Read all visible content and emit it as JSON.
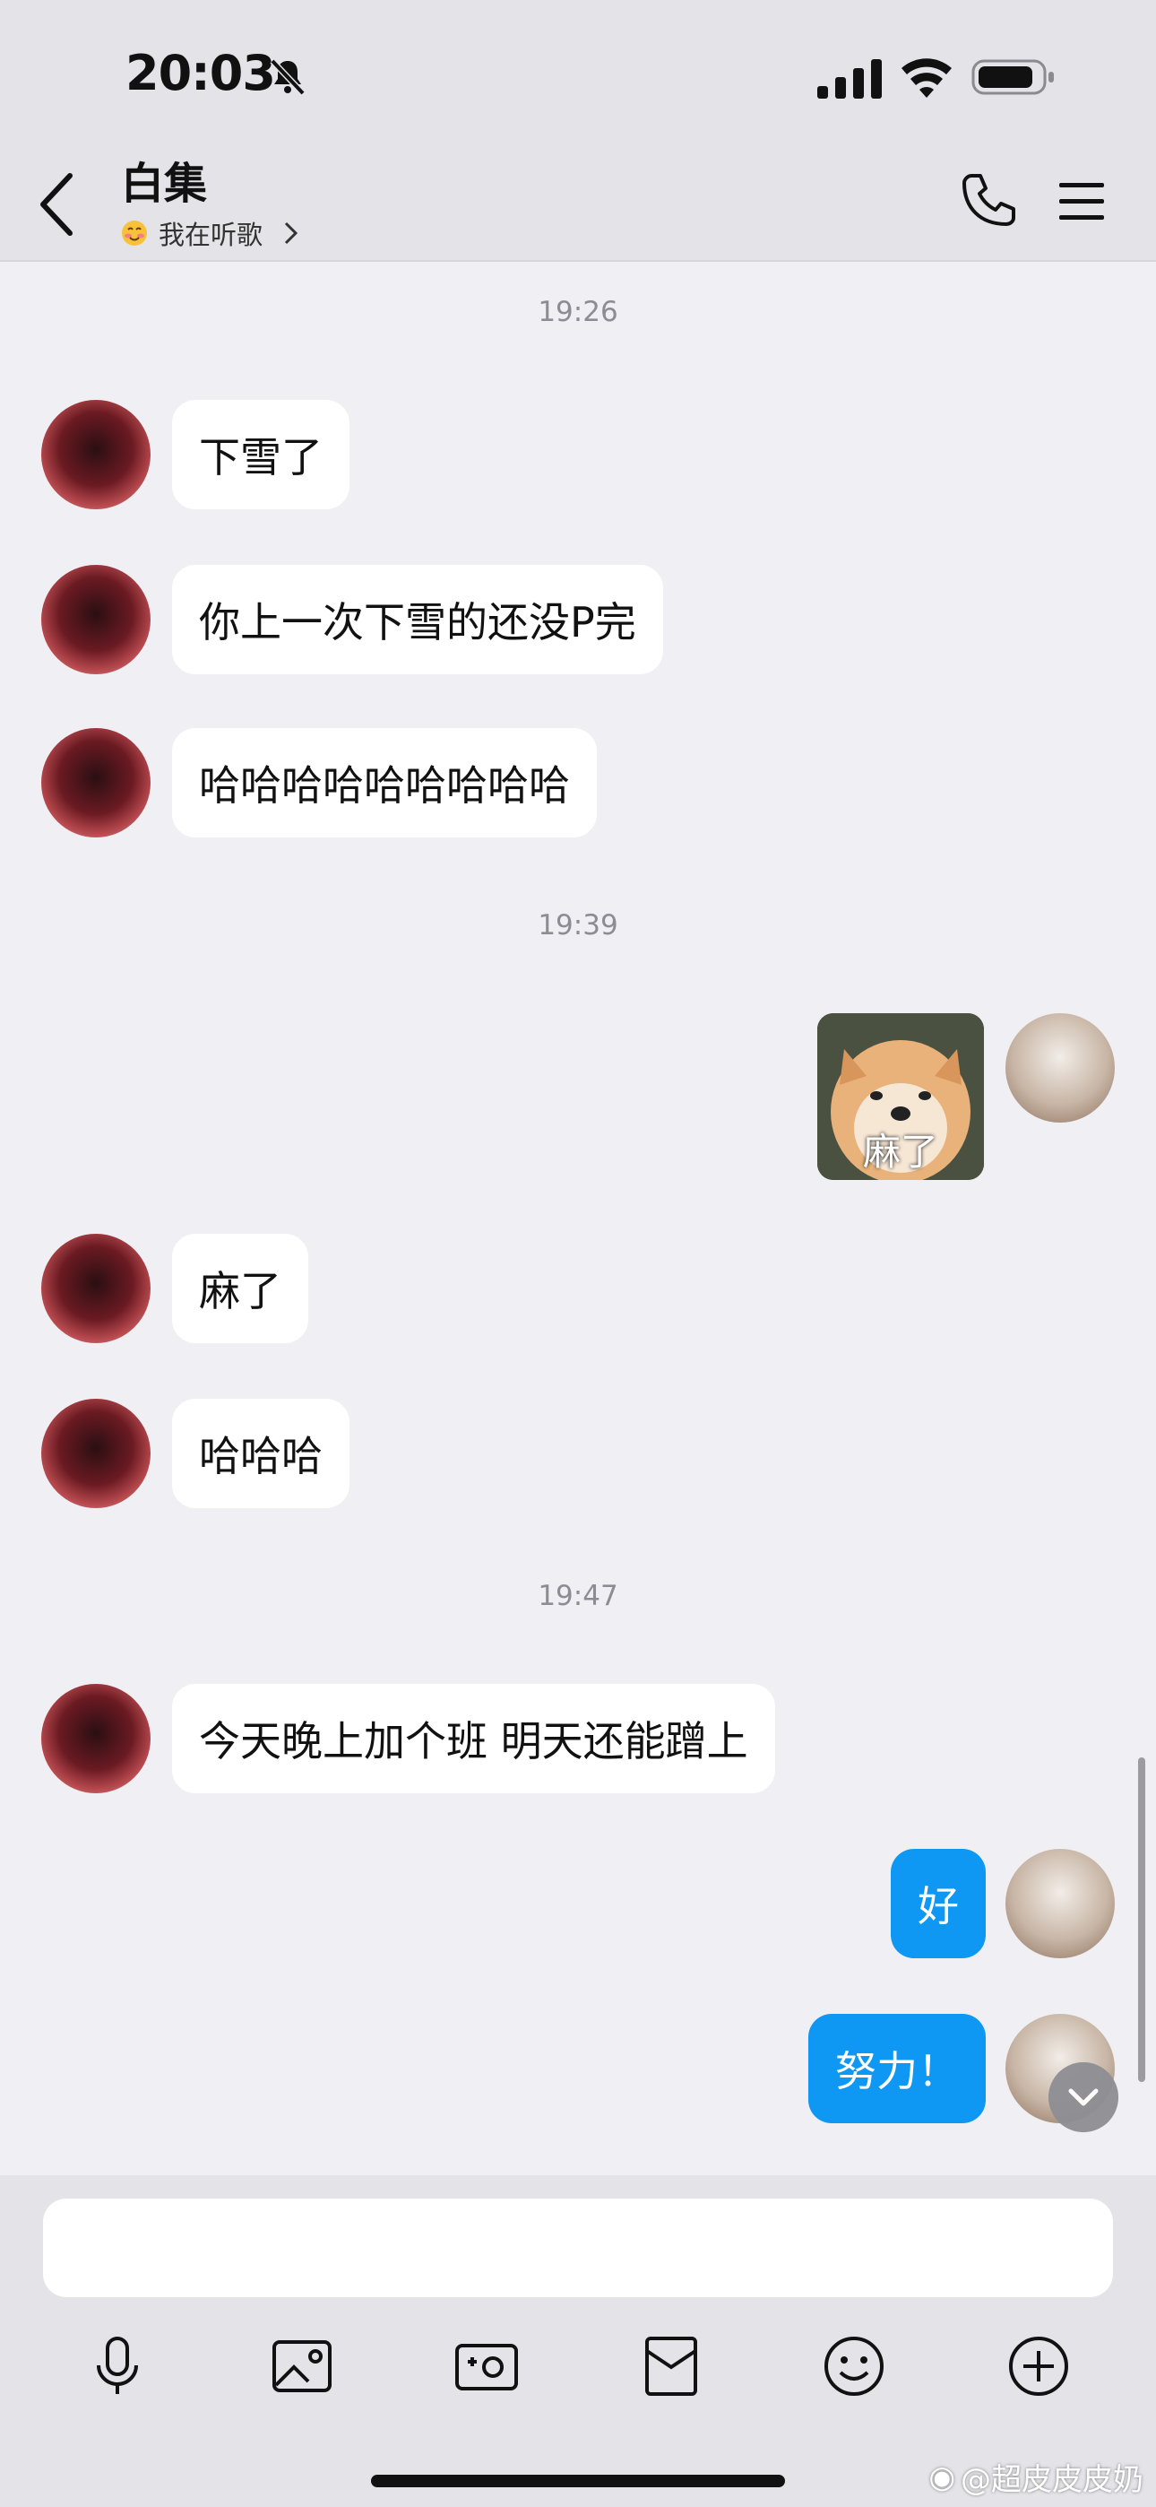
{
  "status_bar": {
    "time": "20:03"
  },
  "header": {
    "title": "白集",
    "status_text": "我在听歌"
  },
  "messages": [
    {
      "type": "timestamp",
      "text": "19:26"
    },
    {
      "type": "text",
      "side": "left",
      "text": "下雪了"
    },
    {
      "type": "text",
      "side": "left",
      "text": "你上一次下雪的还没P完"
    },
    {
      "type": "text",
      "side": "left",
      "text": "哈哈哈哈哈哈哈哈哈"
    },
    {
      "type": "timestamp",
      "text": "19:39"
    },
    {
      "type": "sticker",
      "side": "right",
      "caption": "麻了"
    },
    {
      "type": "text",
      "side": "left",
      "text": "麻了"
    },
    {
      "type": "text",
      "side": "left",
      "text": "哈哈哈"
    },
    {
      "type": "timestamp",
      "text": "19:47"
    },
    {
      "type": "text",
      "side": "left",
      "text": "今天晚上加个班 明天还能蹭上"
    },
    {
      "type": "text",
      "side": "right",
      "text": "好"
    },
    {
      "type": "text",
      "side": "right",
      "text": "努力！"
    }
  ],
  "input": {
    "value": ""
  },
  "toolbar": {
    "icons": [
      "microphone-icon",
      "image-icon",
      "camera-icon",
      "red-packet-icon",
      "emoji-icon",
      "plus-icon"
    ]
  },
  "watermark": {
    "text": "@超皮皮皮奶"
  },
  "colors": {
    "outgoing_bubble": "#0e98f3",
    "incoming_bubble": "#ffffff",
    "background": "#efeff4",
    "bar_background": "#e3e3e8"
  }
}
